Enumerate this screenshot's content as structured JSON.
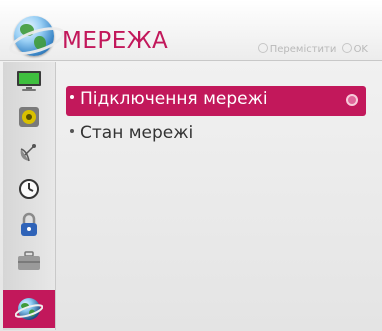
{
  "header": {
    "title": "МЕРЕЖА",
    "hint_move": "Перемістити",
    "hint_ok": "OK"
  },
  "sidebar": {
    "items": [
      {
        "name": "picture",
        "icon": "monitor-icon"
      },
      {
        "name": "audio",
        "icon": "speaker-icon"
      },
      {
        "name": "channels",
        "icon": "satellite-dish-icon"
      },
      {
        "name": "time",
        "icon": "clock-icon"
      },
      {
        "name": "lock",
        "icon": "padlock-icon"
      },
      {
        "name": "options",
        "icon": "briefcase-icon"
      },
      {
        "name": "network",
        "icon": "globe-icon",
        "active": true
      }
    ]
  },
  "menu": {
    "items": [
      {
        "label": "Підключення мережі",
        "selected": true
      },
      {
        "label": "Стан мережі",
        "selected": false
      }
    ]
  },
  "colors": {
    "accent": "#c2185b",
    "background": "#e9e9e9"
  }
}
